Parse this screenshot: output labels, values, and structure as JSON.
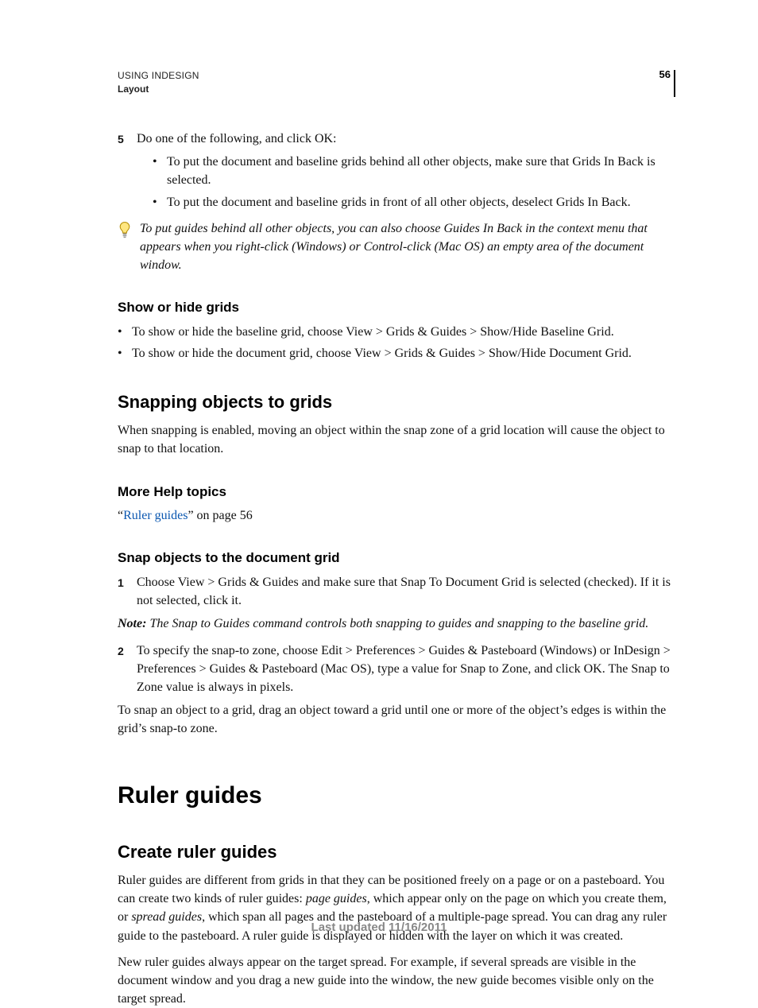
{
  "header": {
    "running_head": "USING INDESIGN",
    "section": "Layout",
    "page_number": "56"
  },
  "step5": {
    "num": "5",
    "intro": "Do one of the following, and click OK:",
    "bullets": [
      "To put the document and baseline grids behind all other objects, make sure that Grids In Back is selected.",
      "To put the document and baseline grids in front of all other objects, deselect Grids In Back."
    ]
  },
  "tip": "To put guides behind all other objects, you can also choose Guides In Back in the context menu that appears when you right-click (Windows) or Control-click (Mac OS) an empty area of the document window.",
  "show_hide": {
    "heading": "Show or hide grids",
    "bullets": [
      "To show or hide the baseline grid, choose View > Grids & Guides > Show/Hide Baseline Grid.",
      "To show or hide the document grid, choose View > Grids & Guides > Show/Hide Document Grid."
    ]
  },
  "snapping": {
    "heading": "Snapping objects to grids",
    "para": "When snapping is enabled, moving an object within the snap zone of a grid location will cause the object to snap to that location."
  },
  "more_help": {
    "heading": "More Help topics",
    "quote_open": "“",
    "link_text": "Ruler guides",
    "after": "” on page 56"
  },
  "snap_doc": {
    "heading": "Snap objects to the document grid",
    "step1_num": "1",
    "step1": "Choose View > Grids & Guides and make sure that Snap To Document Grid is selected (checked). If it is not selected, click it.",
    "note_label": "Note:",
    "note": " The Snap to Guides command controls both snapping to guides and snapping to the baseline grid.",
    "step2_num": "2",
    "step2": "To specify the snap-to zone, choose Edit > Preferences > Guides & Pasteboard (Windows) or InDesign > Preferences > Guides & Pasteboard (Mac OS), type a value for Snap to Zone, and click OK. The Snap to Zone value is always in pixels.",
    "closing": "To snap an object to a grid, drag an object toward a grid until one or more of the object’s edges is within the grid’s snap-to zone."
  },
  "ruler": {
    "h1": "Ruler guides",
    "h2": "Create ruler guides",
    "p1_a": "Ruler guides are different from grids in that they can be positioned freely on a page or on a pasteboard. You can create two kinds of ruler guides: ",
    "p1_i1": "page guides",
    "p1_b": ", which appear only on the page on which you create them, or ",
    "p1_i2": "spread guides",
    "p1_c": ", which span all pages and the pasteboard of a multiple-page spread. You can drag any ruler guide to the pasteboard. A ruler guide is displayed or hidden with the layer on which it was created.",
    "p2": "New ruler guides always appear on the target spread. For example, if several spreads are visible in the document window and you drag a new guide into the window, the new guide becomes visible only on the target spread."
  },
  "footer": "Last updated 11/16/2011"
}
